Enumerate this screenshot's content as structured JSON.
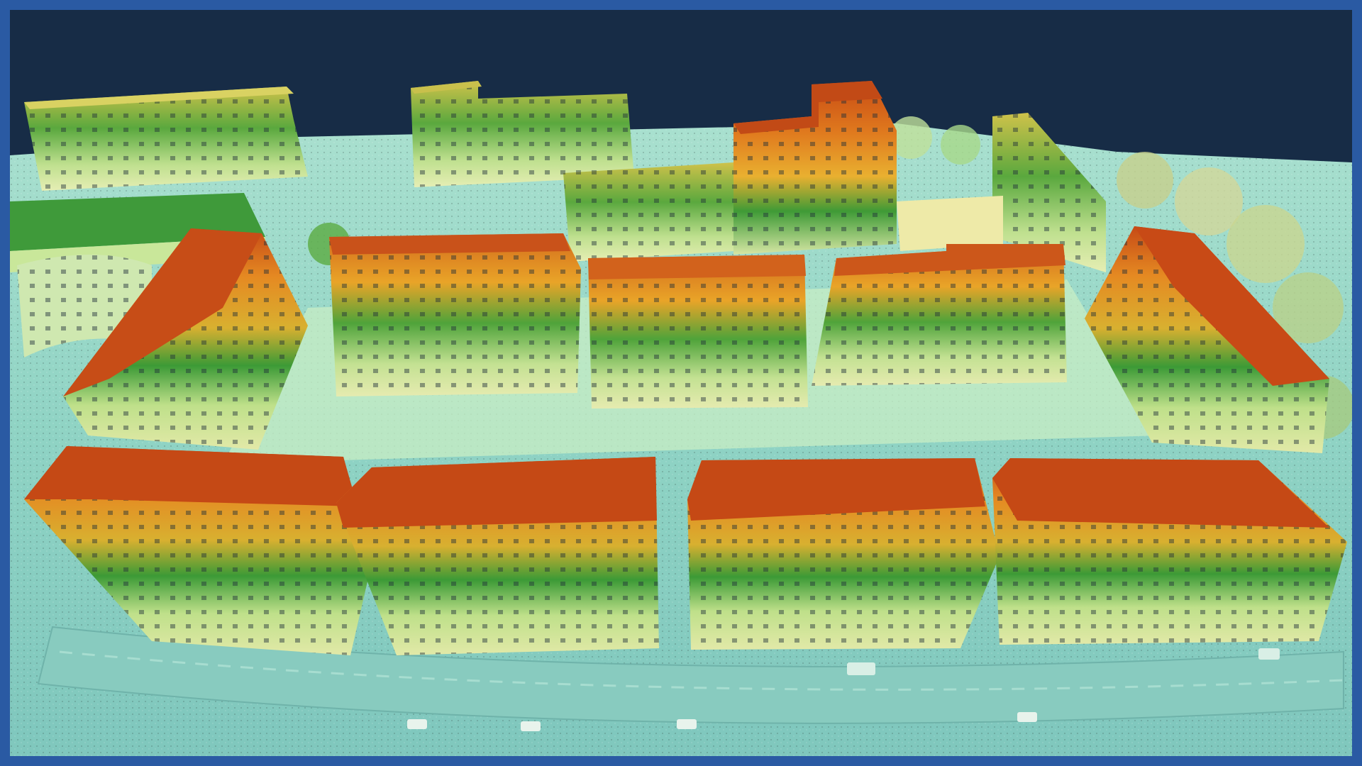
{
  "scene": {
    "kind": "lidar-point-cloud-render",
    "colormap": "height",
    "colors": {
      "frame_border": "#2a5aa3",
      "sky": "#172c46",
      "ground_low": "#8fd6c6",
      "ground_mid": "#b5e6c4",
      "height_low": "#dfe7a2",
      "height_mid": "#3f9a35",
      "height_high": "#e89a1e",
      "height_top": "#c24a16"
    }
  }
}
